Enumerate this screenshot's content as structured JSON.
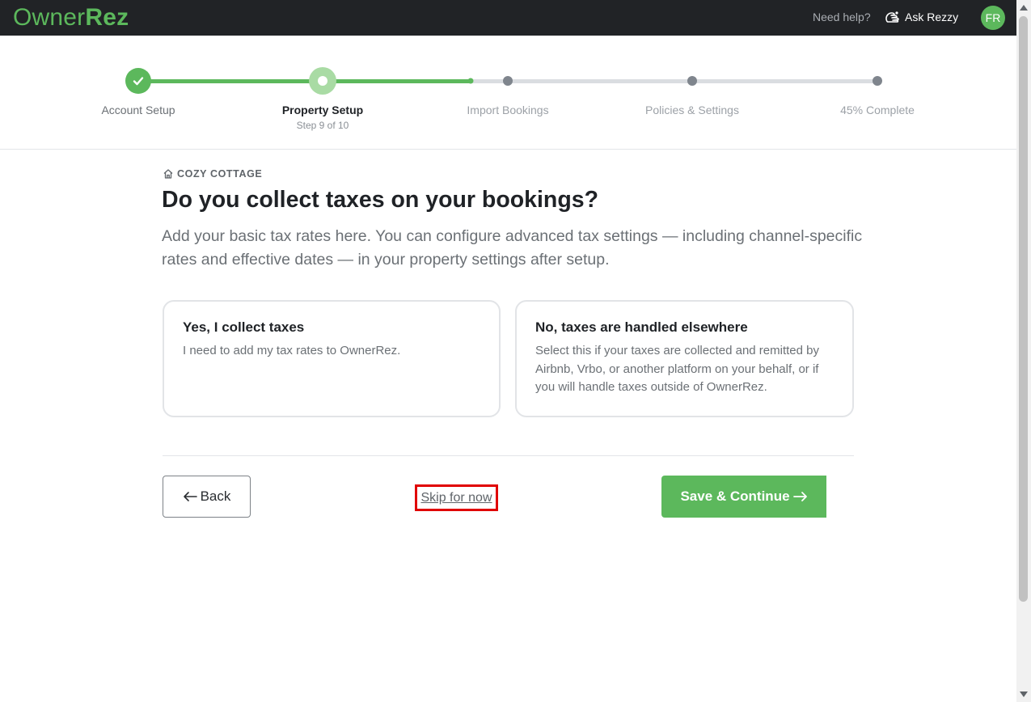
{
  "header": {
    "logo_light": "Owner",
    "logo_bold": "Rez",
    "need_help": "Need help?",
    "ask_rezzy": "Ask Rezzy",
    "avatar_initials": "FR",
    "icons": {
      "ask_rezzy": "helper-hand-icon"
    }
  },
  "stepper": {
    "progress_fraction": 0.45,
    "steps": [
      {
        "label": "Account Setup",
        "status": "complete"
      },
      {
        "label": "Property Setup",
        "status": "current",
        "sub": "Step 9 of 10"
      },
      {
        "label": "Import Bookings",
        "status": "upcoming"
      },
      {
        "label": "Policies & Settings",
        "status": "upcoming"
      },
      {
        "label": "45% Complete",
        "status": "upcoming"
      }
    ]
  },
  "content": {
    "property_name": "COZY COTTAGE",
    "title": "Do you collect taxes on your bookings?",
    "description": "Add your basic tax rates here. You can configure advanced tax settings — including channel-specific rates and effective dates — in your property settings after setup.",
    "options": [
      {
        "title": "Yes, I collect taxes",
        "description": "I need to add my tax rates to OwnerRez."
      },
      {
        "title": "No, taxes are handled elsewhere",
        "description": "Select this if your taxes are collected and remitted by Airbnb, Vrbo, or another platform on your behalf, or if you will handle taxes outside of OwnerRez."
      }
    ]
  },
  "footer": {
    "back_label": "Back",
    "skip_label": "Skip for now",
    "save_label": "Save & Continue"
  },
  "colors": {
    "brand_green": "#5cb85c",
    "topbar": "#212326",
    "highlight_border": "#e00000"
  }
}
